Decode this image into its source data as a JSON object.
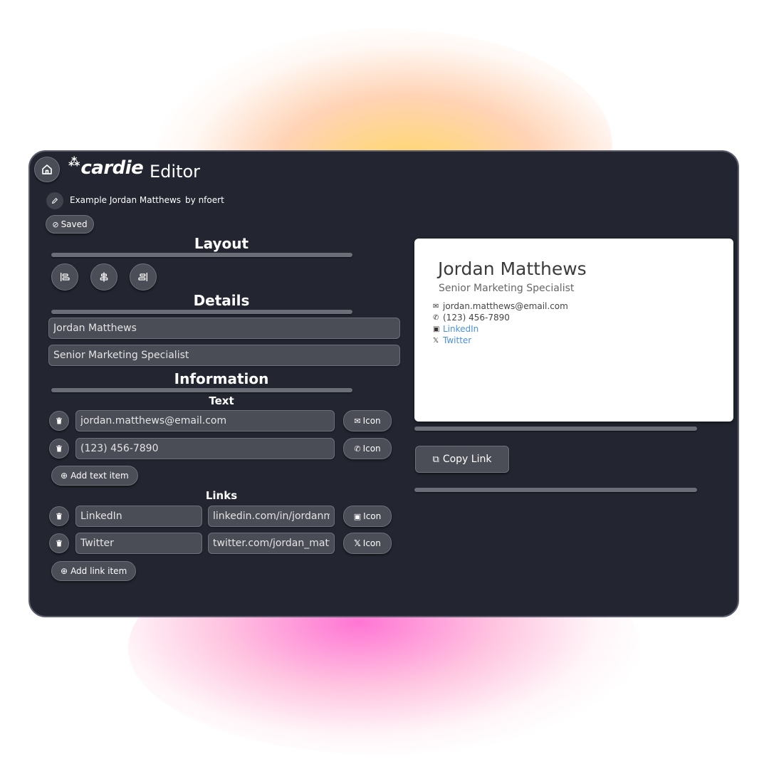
{
  "app": {
    "brand": "cardie",
    "title": "Editor"
  },
  "card_meta": {
    "name": "Example Jordan Matthews",
    "author": "by nfoert"
  },
  "status": {
    "saved_label": "Saved"
  },
  "sections": {
    "layout": "Layout",
    "details": "Details",
    "information": "Information",
    "text": "Text",
    "links": "Links"
  },
  "details": {
    "name_value": "Jordan Matthews",
    "title_value": "Senior Marketing Specialist"
  },
  "text_items": [
    {
      "value": "jordan.matthews@email.com",
      "icon_label": "Icon",
      "icon": "envelope-icon"
    },
    {
      "value": "(123) 456-7890",
      "icon_label": "Icon",
      "icon": "phone-icon"
    }
  ],
  "add_text_label": "Add text item",
  "link_items": [
    {
      "label": "LinkedIn",
      "url": "linkedin.com/in/jordanmat",
      "icon_label": "Icon",
      "icon": "linkedin-icon"
    },
    {
      "label": "Twitter",
      "url": "twitter.com/jordan_matthe",
      "icon_label": "Icon",
      "icon": "x-icon"
    }
  ],
  "add_link_label": "Add link item",
  "preview": {
    "name": "Jordan Matthews",
    "title": "Senior Marketing Specialist",
    "email": "jordan.matthews@email.com",
    "phone": "(123) 456-7890",
    "link1": "LinkedIn",
    "link2": "Twitter"
  },
  "copy_link_label": "Copy Link",
  "colors": {
    "panel_bg": "#232631",
    "control_bg": "#4b4d57",
    "link_blue": "#4a90e2",
    "glow_top": "#ffd65a",
    "glow_bottom": "#ff6ed2"
  }
}
